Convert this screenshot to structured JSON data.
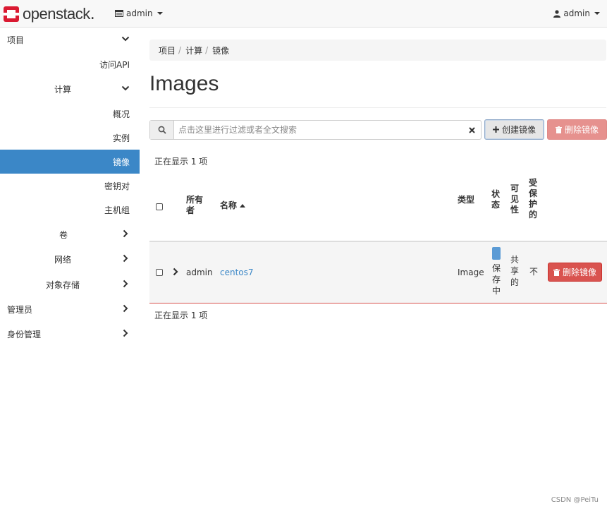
{
  "brand": {
    "name": "openstack",
    "dot": "."
  },
  "topbar": {
    "project": "admin",
    "user": "admin"
  },
  "sidebar": [
    {
      "label": "项目",
      "chevron": "down"
    },
    {
      "label": "访问API"
    },
    {
      "label": "计算",
      "chevron": "down"
    },
    {
      "label": "概况"
    },
    {
      "label": "实例"
    },
    {
      "label": "镜像",
      "active": true
    },
    {
      "label": "密钥对"
    },
    {
      "label": "主机组"
    },
    {
      "label": "卷",
      "chevron": "right"
    },
    {
      "label": "网络",
      "chevron": "right"
    },
    {
      "label": "对象存储",
      "chevron": "right"
    },
    {
      "label": "管理员",
      "chevron": "right"
    },
    {
      "label": "身份管理",
      "chevron": "right"
    }
  ],
  "breadcrumb": [
    "项目",
    "计算",
    "镜像"
  ],
  "page_title": "Images",
  "filter": {
    "placeholder": "点击这里进行过滤或者全文搜索"
  },
  "actions": {
    "create": "创建镜像",
    "delete": "删除镜像"
  },
  "count_text": "正在显示 1 项",
  "table": {
    "headers": {
      "owner": [
        "所有",
        "者"
      ],
      "name": "名称",
      "type": "类型",
      "status": [
        "状",
        "态"
      ],
      "visibility": [
        "可",
        "见",
        "性"
      ],
      "protected": [
        "受",
        "保",
        "护",
        "的"
      ]
    },
    "rows": [
      {
        "owner": "admin",
        "name": "centos7",
        "type": "Image",
        "status": [
          "保",
          "存",
          "中"
        ],
        "visibility": [
          "共",
          "享",
          "的"
        ],
        "protected": "不",
        "action": "删除镜像"
      }
    ]
  },
  "colors": {
    "accent": "#3b87c7",
    "danger": "#d9534f"
  },
  "watermark": "CSDN @PeiTu"
}
